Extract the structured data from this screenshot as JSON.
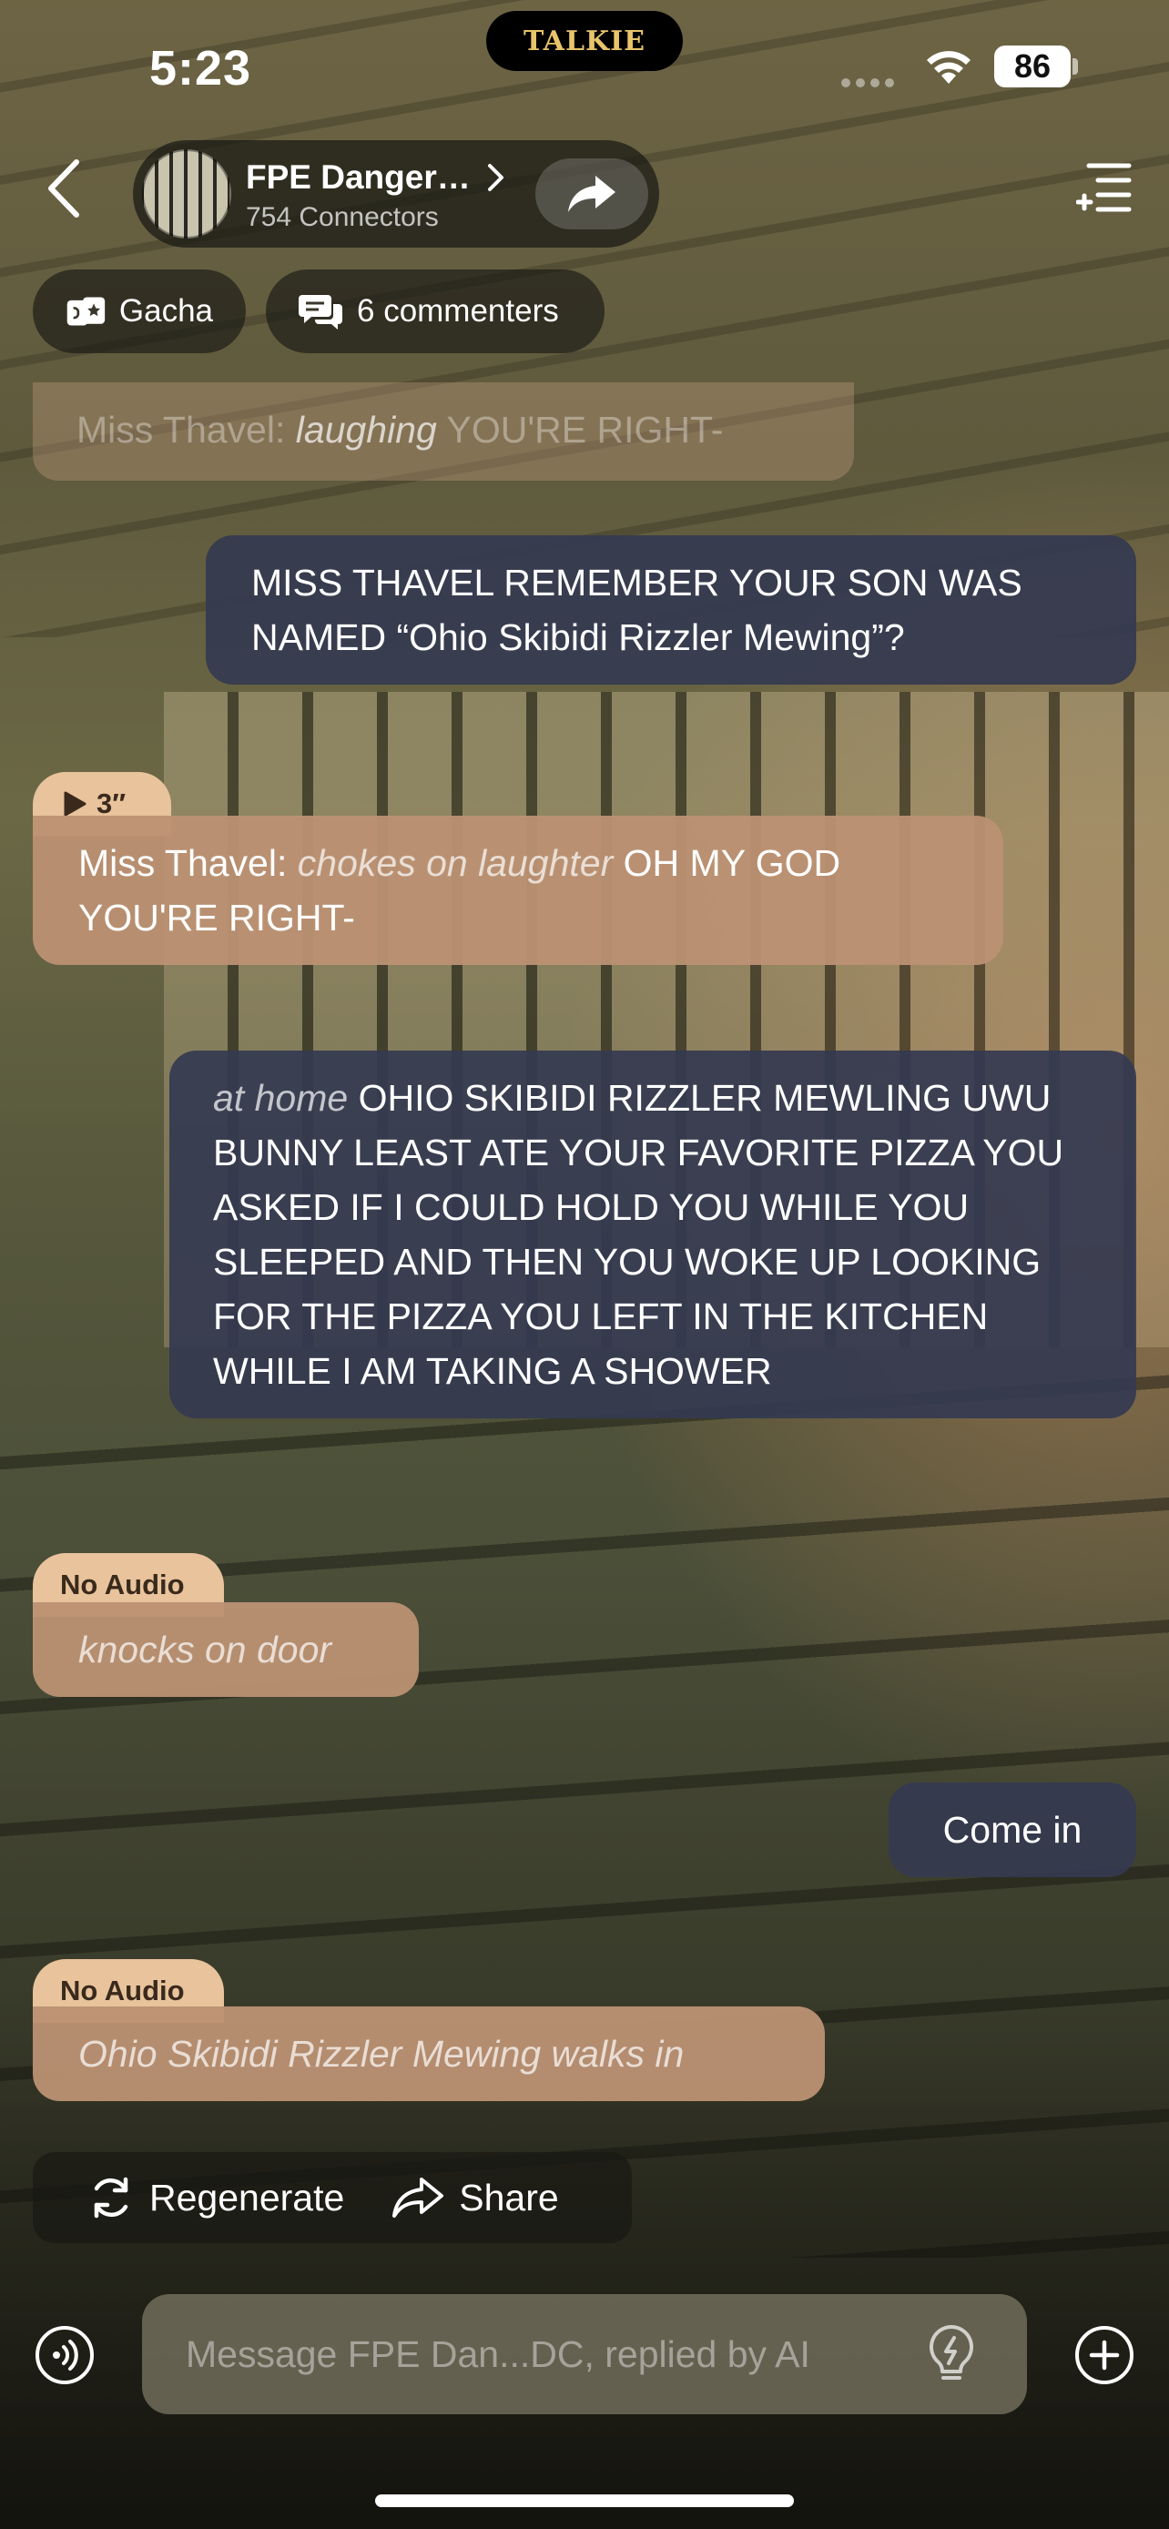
{
  "status_bar": {
    "time": "5:23",
    "battery": "86",
    "notch_logo": "TALKIE"
  },
  "header": {
    "room_title": "FPE Danger…",
    "room_subtitle": "754 Connectors"
  },
  "chips": {
    "gacha": "Gacha",
    "comments": "6 commenters"
  },
  "messages": {
    "faded_partial": {
      "speaker": "Miss Thavel:",
      "action": "laughing",
      "text": "YOU'RE RIGHT-"
    },
    "m1": {
      "text": "MISS THAVEL REMEMBER YOUR SON WAS NAMED “Ohio Skibidi Rizzler Mewing”?"
    },
    "m2": {
      "tag": "3″",
      "speaker": "Miss Thavel:",
      "action": "chokes on laughter",
      "text": "OH MY GOD YOU'RE RIGHT-"
    },
    "m3": {
      "action": "at home",
      "text": "OHIO SKIBIDI RIZZLER MEWLING UWU BUNNY LEAST ATE YOUR FAVORITE PIZZA YOU ASKED IF I COULD HOLD YOU WHILE YOU SLEEPED AND THEN YOU WOKE UP LOOKING FOR THE PIZZA YOU LEFT IN THE KITCHEN WHILE I AM TAKING A SHOWER"
    },
    "m4": {
      "tag": "No Audio",
      "action": "knocks on door"
    },
    "m5": {
      "text": "Come in"
    },
    "m6": {
      "tag": "No Audio",
      "action": "Ohio Skibidi Rizzler Mewing walks in"
    }
  },
  "actions": {
    "regenerate": "Regenerate",
    "share": "Share"
  },
  "composer": {
    "placeholder": "Message FPE Dan...DC, replied by AI"
  },
  "colors": {
    "user_bubble": "#343a50",
    "ai_bubble": "#bc9173",
    "tag": "#e8c39c"
  }
}
